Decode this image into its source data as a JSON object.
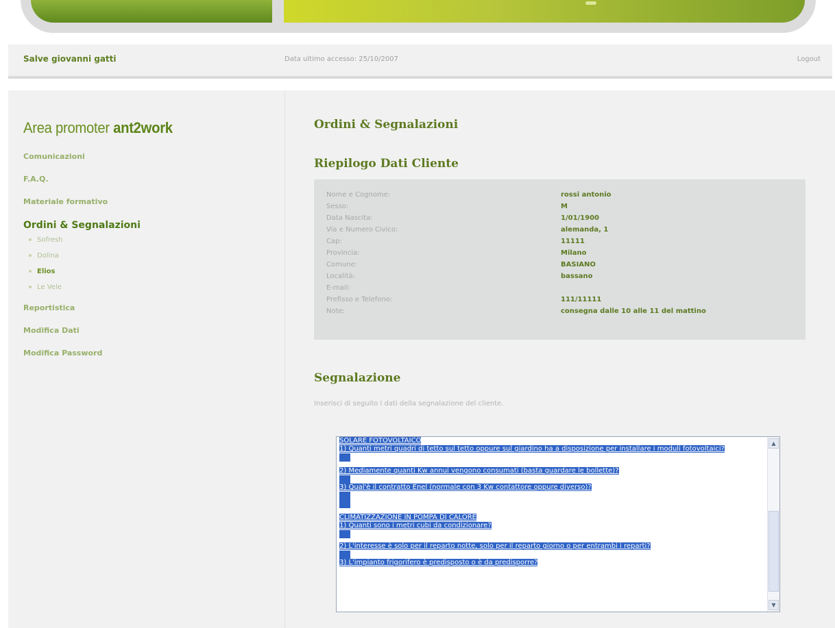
{
  "header": {
    "greeting": "Salve giovanni gatti",
    "last_access": "Data ultimo accesso: 25/10/2007",
    "logout": "Logout"
  },
  "sidebar": {
    "brand_light": "Area promoter ",
    "brand_bold": "ant2work",
    "items": [
      {
        "label": "Comunicazioni"
      },
      {
        "label": "F.A.Q."
      },
      {
        "label": "Materiale formativo"
      },
      {
        "label": "Ordini & Segnalazioni"
      },
      {
        "label": "Reportistica"
      },
      {
        "label": "Modifica Dati"
      },
      {
        "label": "Modifica Password"
      }
    ],
    "subitems": [
      {
        "label": "Sofresh"
      },
      {
        "label": "Dolina"
      },
      {
        "label": "Elios"
      },
      {
        "label": "Le Vele"
      }
    ]
  },
  "main": {
    "title": "Ordini & Segnalazioni",
    "summary_title": "Riepilogo Dati Cliente",
    "fields": [
      {
        "label": "Nome e Cognome:",
        "value": "rossi antonio"
      },
      {
        "label": "Sesso:",
        "value": "M"
      },
      {
        "label": "Data Nascita:",
        "value": "1/01/1900"
      },
      {
        "label": "Via e Numero Civico:",
        "value": "alemanda, 1"
      },
      {
        "label": "Cap:",
        "value": "11111"
      },
      {
        "label": "Provincia:",
        "value": "Milano"
      },
      {
        "label": "Comune:",
        "value": "BASIANO"
      },
      {
        "label": "Località:",
        "value": "bassano"
      },
      {
        "label": "E-mail:",
        "value": ""
      },
      {
        "label": "Prefisso e Telefono:",
        "value": "111/11111"
      },
      {
        "label": "Note:",
        "value": "consegna dalle 10 alle 11 del mattino"
      }
    ],
    "report_title": "Segnalazione",
    "report_intro": "Inserisci di seguito i dati della segnalazione del cliente.",
    "textarea": {
      "lines": [
        "SOLARE FOTOVOLTAICO",
        "1) Quanti metri quadri di tetto sul tetto oppure sul giardino ha a disposizione per installare i moduli fotovoltaici?",
        "",
        "2) Mediamente quanti Kw annui vengono consumati (basta guardare le bollette)?",
        "",
        "3) Qual'è il contratto Enel (normale con 3 Kw contattore oppure diverso)?",
        "",
        "",
        "CLIMATIZZAZIONE IN POMPA DI CALORE",
        "1) Quanti sono i metri cubi da condizionare?",
        "",
        "2) L'interesse è solo per il reparto notte, solo per il reparto giorno o per entrambi i reparti?",
        "",
        "3) L'impianto frigorifero è predisposto o è da predisporre?"
      ]
    }
  }
}
